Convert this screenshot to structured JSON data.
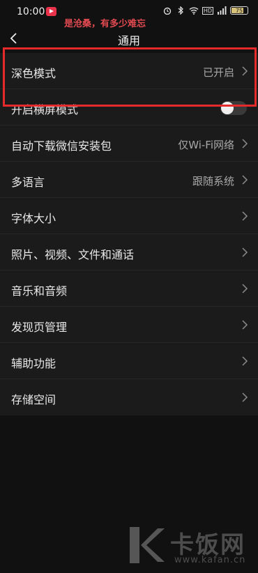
{
  "status_bar": {
    "time": "10:00",
    "network_badge": "HD",
    "battery_level": "75"
  },
  "overlay_caption": "是沧桑，有多少难忘",
  "nav": {
    "title": "通用"
  },
  "settings": [
    {
      "label": "深色模式",
      "value": "已开启",
      "control": "chevron"
    },
    {
      "label": "开启横屏模式",
      "value": "",
      "control": "toggle",
      "toggle_on": false
    },
    {
      "label": "自动下载微信安装包",
      "value": "仅Wi-Fi网络",
      "control": "chevron"
    },
    {
      "label": "多语言",
      "value": "跟随系统",
      "control": "chevron"
    },
    {
      "label": "字体大小",
      "value": "",
      "control": "chevron"
    },
    {
      "label": "照片、视频、文件和通话",
      "value": "",
      "control": "chevron"
    },
    {
      "label": "音乐和音频",
      "value": "",
      "control": "chevron"
    },
    {
      "label": "发现页管理",
      "value": "",
      "control": "chevron"
    },
    {
      "label": "辅助功能",
      "value": "",
      "control": "chevron"
    },
    {
      "label": "存储空间",
      "value": "",
      "control": "chevron"
    }
  ],
  "watermark": {
    "brand": "卡饭网",
    "url": "www.kafan.cn"
  },
  "colors": {
    "background": "#111111",
    "list_background": "#1b1b1b",
    "highlight_border": "#e42a2a",
    "caption": "#e04a50"
  }
}
